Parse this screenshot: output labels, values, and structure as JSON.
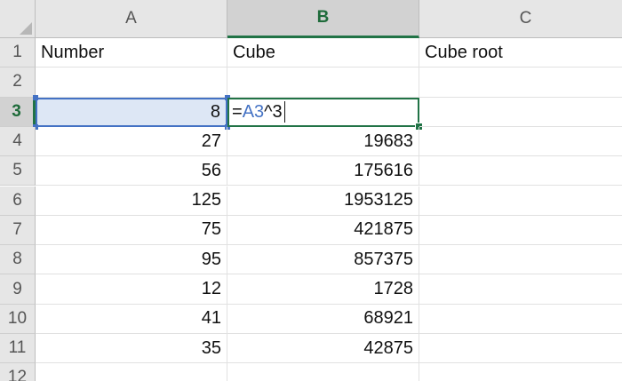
{
  "columns": [
    {
      "letter": "A",
      "active": false
    },
    {
      "letter": "B",
      "active": true
    },
    {
      "letter": "C",
      "active": false
    }
  ],
  "rows": [
    {
      "num": "1",
      "a": "Number",
      "b": "Cube",
      "c": "Cube root"
    },
    {
      "num": "2",
      "a": "",
      "b": "",
      "c": ""
    },
    {
      "num": "3",
      "a": "8",
      "b": "",
      "c": ""
    },
    {
      "num": "4",
      "a": "27",
      "b": "19683",
      "c": ""
    },
    {
      "num": "5",
      "a": "56",
      "b": "175616",
      "c": ""
    },
    {
      "num": "6",
      "a": "125",
      "b": "1953125",
      "c": ""
    },
    {
      "num": "7",
      "a": "75",
      "b": "421875",
      "c": ""
    },
    {
      "num": "8",
      "a": "95",
      "b": "857375",
      "c": ""
    },
    {
      "num": "9",
      "a": "12",
      "b": "1728",
      "c": ""
    },
    {
      "num": "10",
      "a": "41",
      "b": "68921",
      "c": ""
    },
    {
      "num": "11",
      "a": "35",
      "b": "42875",
      "c": ""
    },
    {
      "num": "12",
      "a": "",
      "b": "",
      "c": ""
    }
  ],
  "active_row": "3",
  "formula": {
    "eq": "=",
    "ref": "A3",
    "op": "^3"
  },
  "colors": {
    "accent_green": "#217346",
    "reference_blue": "#4472c4",
    "reference_fill": "#dde7f5",
    "header_bg": "#e6e6e6"
  }
}
